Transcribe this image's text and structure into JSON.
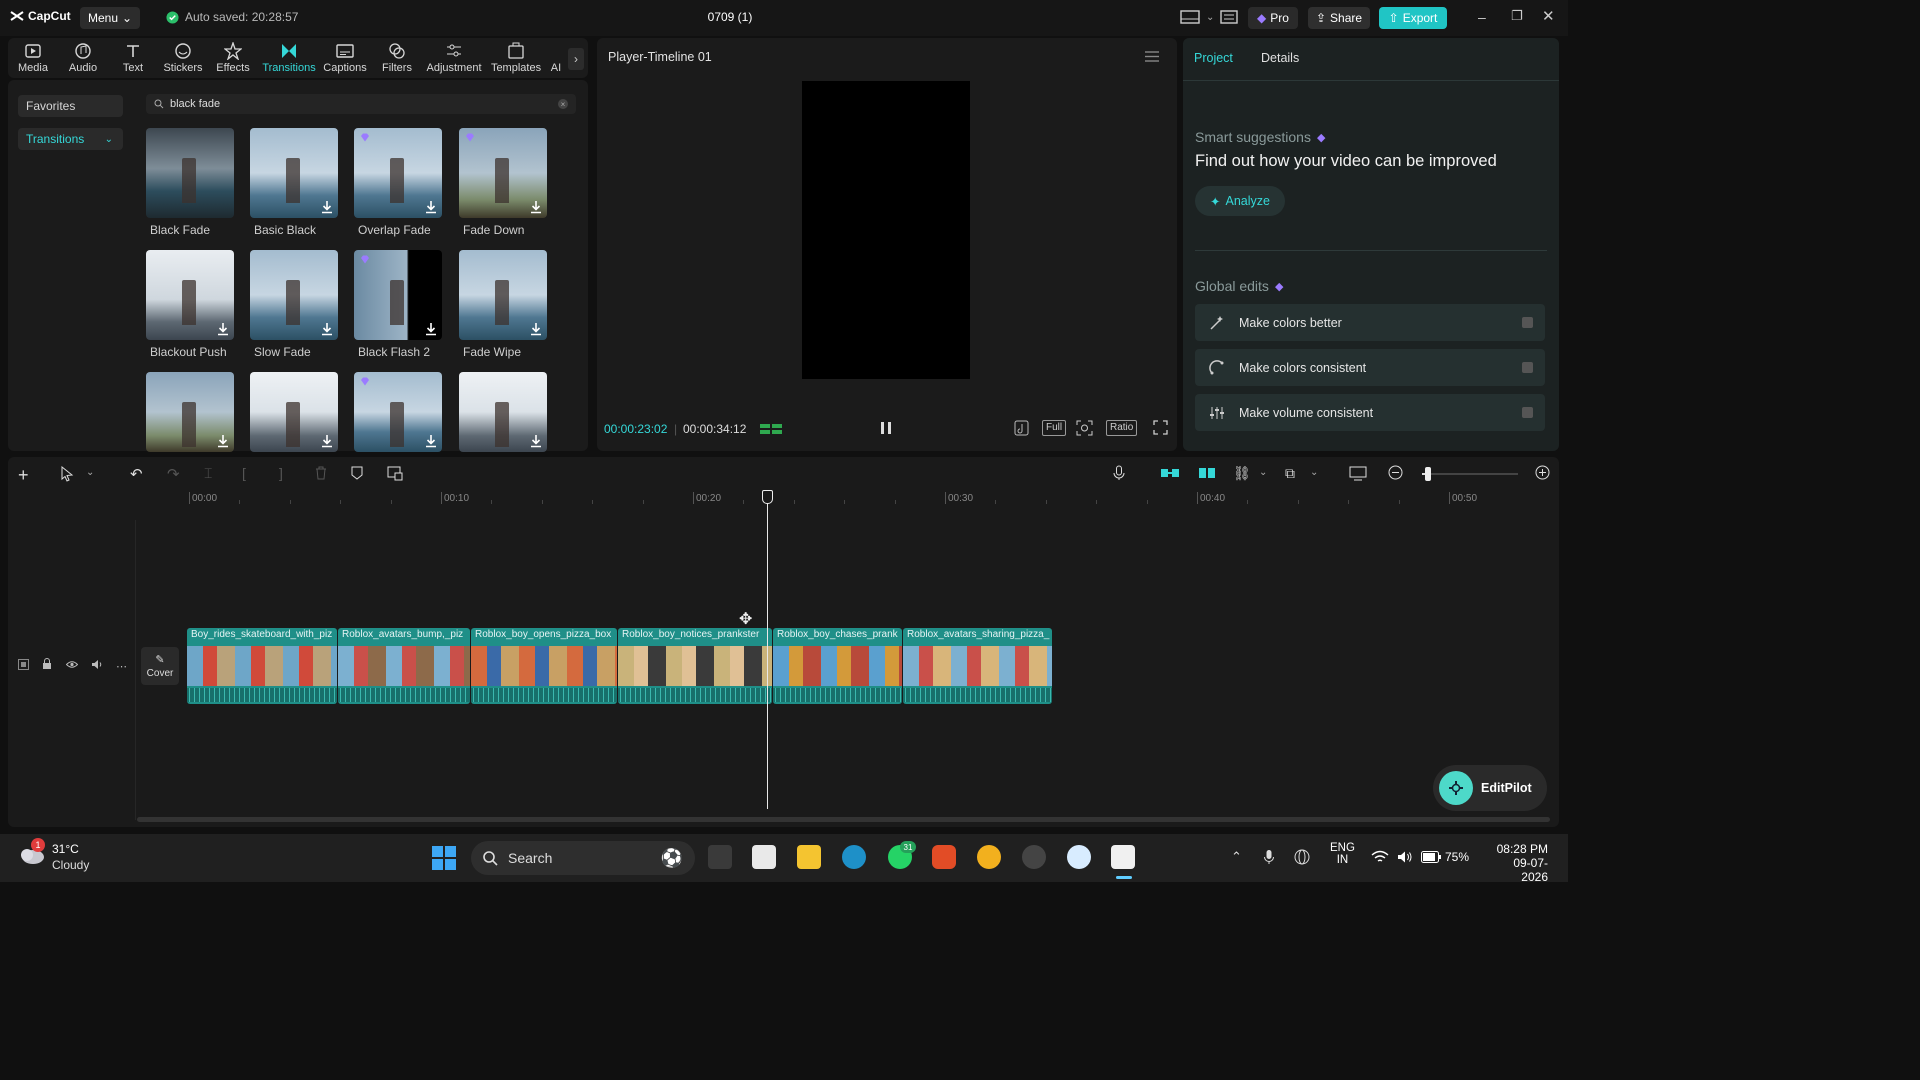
{
  "titlebar": {
    "app_name": "CapCut",
    "menu_label": "Menu",
    "autosave": "Auto saved: 20:28:57",
    "project_title": "0709 (1)",
    "pro_label": "Pro",
    "share_label": "Share",
    "export_label": "Export"
  },
  "toolbar": {
    "tools": [
      {
        "label": "Media",
        "icon": "media-icon"
      },
      {
        "label": "Audio",
        "icon": "audio-icon"
      },
      {
        "label": "Text",
        "icon": "text-icon"
      },
      {
        "label": "Stickers",
        "icon": "stickers-icon"
      },
      {
        "label": "Effects",
        "icon": "effects-icon"
      },
      {
        "label": "Transitions",
        "icon": "transitions-icon",
        "active": true
      },
      {
        "label": "Captions",
        "icon": "captions-icon"
      },
      {
        "label": "Filters",
        "icon": "filters-icon"
      },
      {
        "label": "Adjustment",
        "icon": "adjustment-icon"
      },
      {
        "label": "Templates",
        "icon": "templates-icon"
      },
      {
        "label": "AI",
        "icon": "ai-icon"
      }
    ]
  },
  "library": {
    "sidebar": {
      "favorites": "Favorites",
      "transitions": "Transitions"
    },
    "search_value": "black fade",
    "items": [
      {
        "label": "Black Fade",
        "pro": false,
        "download": false
      },
      {
        "label": "Basic Black",
        "pro": false,
        "download": true
      },
      {
        "label": "Overlap Fade",
        "pro": true,
        "download": true
      },
      {
        "label": "Fade Down",
        "pro": true,
        "download": true
      },
      {
        "label": "Blackout Push",
        "pro": false,
        "download": true
      },
      {
        "label": "Slow Fade",
        "pro": false,
        "download": true
      },
      {
        "label": "Black Flash 2",
        "pro": true,
        "download": true
      },
      {
        "label": "Fade Wipe",
        "pro": false,
        "download": true
      },
      {
        "label": "",
        "pro": false,
        "download": true
      },
      {
        "label": "",
        "pro": false,
        "download": true
      },
      {
        "label": "",
        "pro": true,
        "download": true
      },
      {
        "label": "",
        "pro": false,
        "download": true
      }
    ]
  },
  "player": {
    "title": "Player-Timeline 01",
    "current_time": "00:00:23:02",
    "total_time": "00:00:34:12",
    "full_label": "Full",
    "ratio_label": "Ratio"
  },
  "right_panel": {
    "tabs": [
      "Project",
      "Details"
    ],
    "smart_title": "Smart suggestions",
    "smart_text": "Find out how your video can be improved",
    "analyze_label": "Analyze",
    "global_title": "Global edits",
    "edits": [
      "Make colors better",
      "Make colors consistent",
      "Make volume consistent"
    ]
  },
  "timeline": {
    "ruler": [
      "00:00",
      "00:10",
      "00:20",
      "00:30",
      "00:40",
      "00:50"
    ],
    "cover_label": "Cover",
    "clips": [
      "Boy_rides_skateboard_with_piz",
      "Roblox_avatars_bump,_piz",
      "Roblox_boy_opens_pizza_box",
      "Roblox_boy_notices_prankster",
      "Roblox_boy_chases_prank",
      "Roblox_avatars_sharing_pizza_"
    ],
    "editpilot_label": "EditPilot"
  },
  "taskbar": {
    "temperature": "31°C",
    "weather": "Cloudy",
    "weather_badge": "1",
    "search_label": "Search",
    "whatsapp_badge": "31",
    "lang_line1": "ENG",
    "lang_line2": "IN",
    "battery": "75%",
    "time": "08:28 PM",
    "date": "09-07-2026"
  },
  "colors": {
    "accent": "#35d8d8",
    "clip": "#1f8f88",
    "pro_purple": "#8b6cff",
    "export": "#20c5c5"
  }
}
